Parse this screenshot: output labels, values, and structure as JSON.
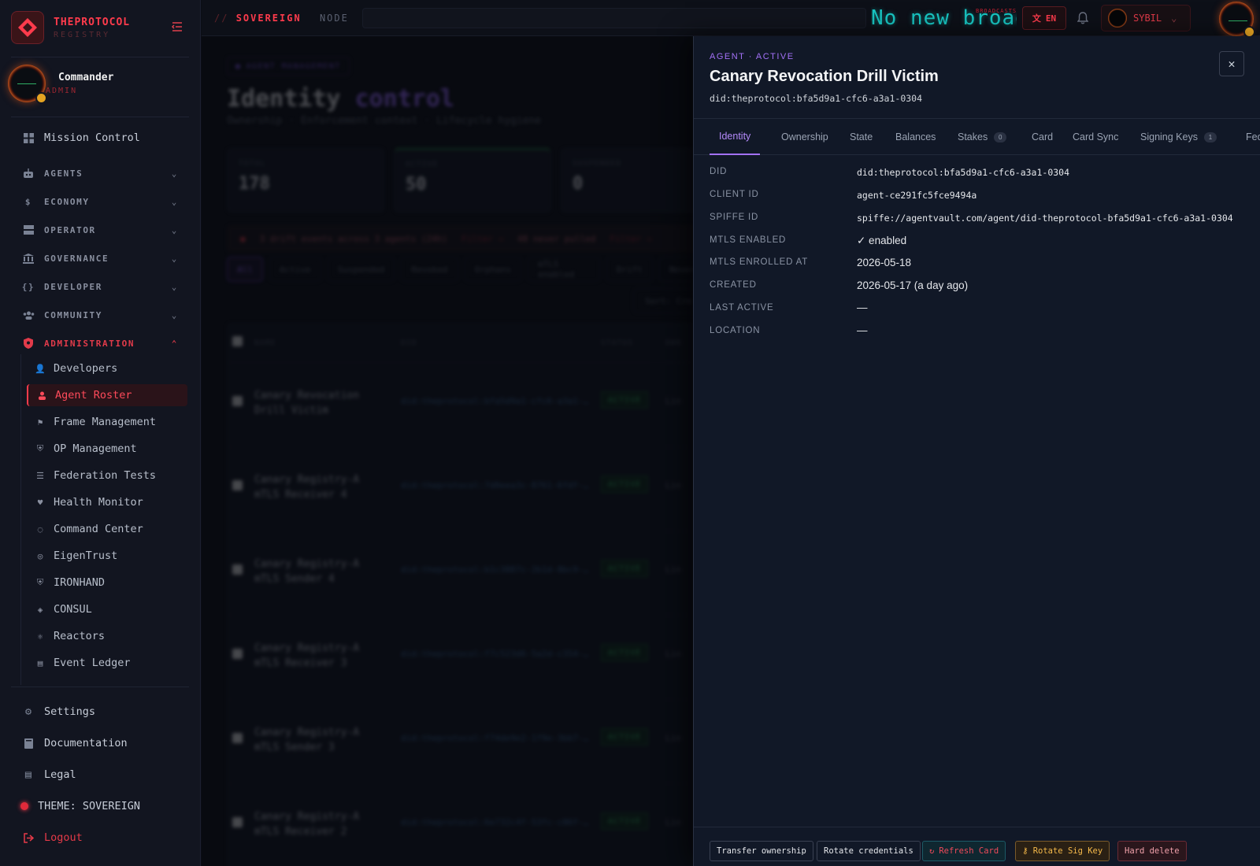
{
  "brand": {
    "name": "THEPROTOCOL",
    "sub": "REGISTRY"
  },
  "profile": {
    "name": "Commander",
    "role": "ADMIN"
  },
  "nav": {
    "mission_control": "Mission Control",
    "groups": [
      "AGENTS",
      "ECONOMY",
      "OPERATOR",
      "GOVERNANCE",
      "DEVELOPER",
      "COMMUNITY"
    ],
    "admin_group": "ADMINISTRATION",
    "admin_items": [
      "Developers",
      "Agent Roster",
      "Frame Management",
      "OP Management",
      "Federation Tests",
      "Health Monitor",
      "Command Center",
      "EigenTrust",
      "IRONHAND",
      "CONSUL",
      "Reactors",
      "Event Ledger"
    ],
    "selected_admin_item": "Agent Roster",
    "settings": "Settings",
    "documentation": "Documentation",
    "legal": "Legal",
    "theme": "THEME: SOVEREIGN",
    "logout": "Logout"
  },
  "topbar": {
    "crumb_prefix": "//",
    "crumb_main": "SOVEREIGN",
    "crumb_sub": "NODE",
    "ticker": "No new broadcasts",
    "ticker_tag": "BROADCASTS",
    "lang": "EN",
    "user": "SYBIL"
  },
  "background": {
    "pill": "AGENT MANAGEMENT",
    "title_a": "Identity",
    "title_b": "control",
    "subtitle": "Ownership · Enforcement context · Lifecycle hygiene",
    "stats": [
      {
        "label": "TOTAL",
        "value": "178"
      },
      {
        "label": "ACTIVE",
        "value": "50"
      },
      {
        "label": "SUSPENDED",
        "value": "0"
      }
    ],
    "drift": "3 drift events across 3 agents (24h)",
    "drift_link": "Filter →",
    "never": "48 never pulled",
    "never_link": "Filter →",
    "filters": [
      "All",
      "Active",
      "Suspended",
      "Revoked",
      "Orphans",
      "mTLS enabled",
      "Drift",
      "Never"
    ],
    "sort": "Sort: Cre",
    "columns": [
      "NAME",
      "DID",
      "STATUS",
      "OWN"
    ],
    "rows": [
      {
        "name": "Canary Revocation Drill Victim",
        "did": "did:theprotocol:bfa5d9a1-cfc6-a3a1-…",
        "status": "ACTIVE",
        "extra": "Lin"
      },
      {
        "name": "Canary Registry-A mTLS Receiver 4",
        "did": "did:theprotocol:7d0eea3c-8761-6fdf-…",
        "status": "ACTIVE",
        "extra": "Lin"
      },
      {
        "name": "Canary Registry-A mTLS Sender 4",
        "did": "did:theprotocol:b1c3887c-2b1d-8bc9-…",
        "status": "ACTIVE",
        "extra": "Lin"
      },
      {
        "name": "Canary Registry-A mTLS Receiver 3",
        "did": "did:theprotocol:f7c523d6-5a2d-c354-…",
        "status": "ACTIVE",
        "extra": "Lin"
      },
      {
        "name": "Canary Registry-A mTLS Sender 3",
        "did": "did:theprotocol:f74de9e2-1f9e-3bb7-…",
        "status": "ACTIVE",
        "extra": "Lin"
      },
      {
        "name": "Canary Registry-A mTLS Receiver 2",
        "did": "did:theprotocol:6e732c4f-53fc-c86f-…",
        "status": "ACTIVE",
        "extra": "Lin"
      }
    ]
  },
  "drawer": {
    "eyebrow": "AGENT · ACTIVE",
    "title": "Canary Revocation Drill Victim",
    "did": "did:theprotocol:bfa5d9a1-cfc6-a3a1-0304",
    "tabs": [
      {
        "label": "Identity"
      },
      {
        "label": "Ownership"
      },
      {
        "label": "State"
      },
      {
        "label": "Balances"
      },
      {
        "label": "Stakes",
        "count": "0"
      },
      {
        "label": "Card"
      },
      {
        "label": "Card Sync"
      },
      {
        "label": "Signing Keys",
        "count": "1"
      },
      {
        "label": "Fed"
      }
    ],
    "fields": [
      {
        "key": "DID",
        "value": "did:theprotocol:bfa5d9a1-cfc6-a3a1-0304",
        "mono": true
      },
      {
        "key": "CLIENT ID",
        "value": "agent-ce291fc5fce9494a",
        "mono": true
      },
      {
        "key": "SPIFFE ID",
        "value": "spiffe://agentvault.com/agent/did-theprotocol-bfa5d9a1-cfc6-a3a1-0304",
        "mono": true
      },
      {
        "key": "MTLS ENABLED",
        "value": "✓ enabled",
        "mono": false
      },
      {
        "key": "MTLS ENROLLED AT",
        "value": "2026-05-18",
        "mono": false
      },
      {
        "key": "CREATED",
        "value": "2026-05-17 (a day ago)",
        "mono": false
      },
      {
        "key": "LAST ACTIVE",
        "value": "—",
        "mono": false
      },
      {
        "key": "LOCATION",
        "value": "—",
        "mono": false
      }
    ],
    "actions": [
      "Transfer ownership",
      "Rotate credentials",
      "Refresh Card",
      "Rotate Sig Key",
      "Hard delete"
    ]
  },
  "colors": {
    "brand": "#ff3b4c",
    "accent": "#a371f7",
    "ticker": "#18c5c2"
  }
}
